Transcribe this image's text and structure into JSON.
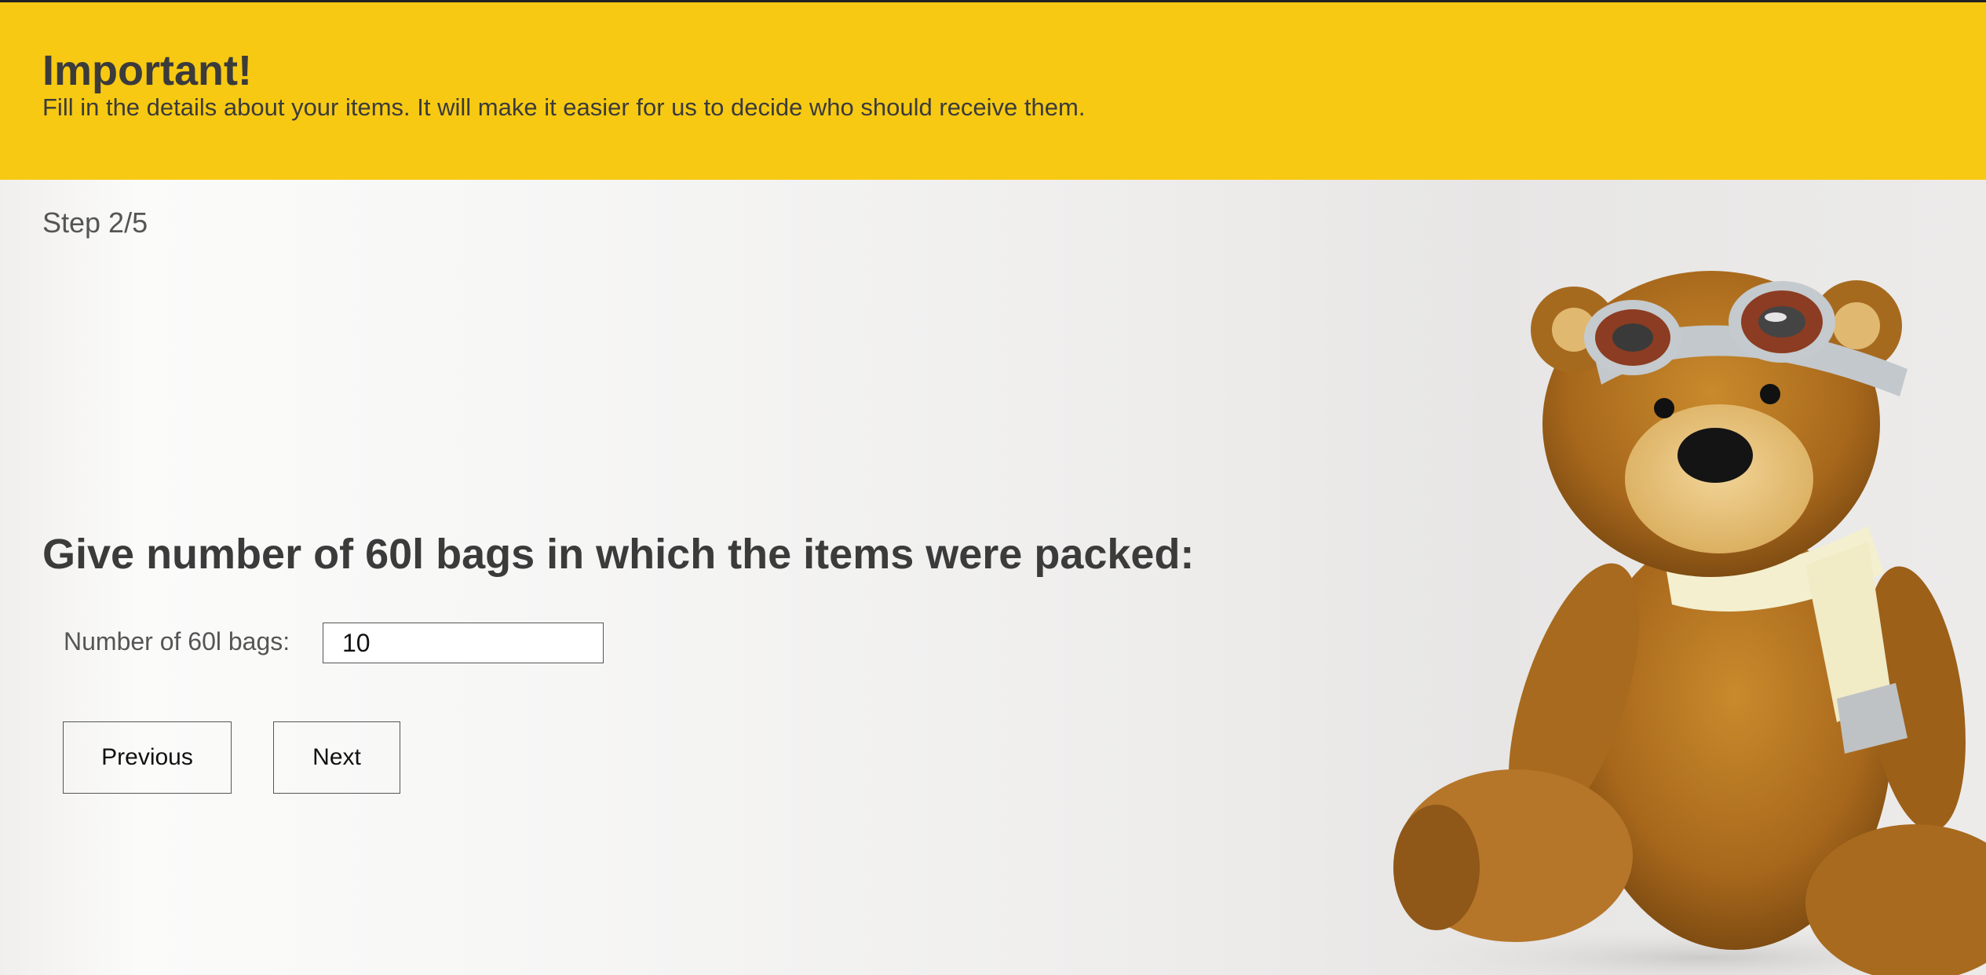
{
  "banner": {
    "title": "Important!",
    "text": "Fill in the details about your items. It will make it easier for us to decide who should receive them."
  },
  "step": {
    "label": "Step 2/5"
  },
  "question": {
    "title": "Give number of 60l bags in which the items were packed:"
  },
  "form": {
    "bags_label": "Number of 60l bags:",
    "bags_value": "10"
  },
  "buttons": {
    "previous": "Previous",
    "next": "Next"
  },
  "colors": {
    "banner": "#f7c912",
    "text": "#3b3b3b"
  },
  "image": {
    "subject": "teddy-bear-with-aviator-goggles-and-scarf"
  }
}
